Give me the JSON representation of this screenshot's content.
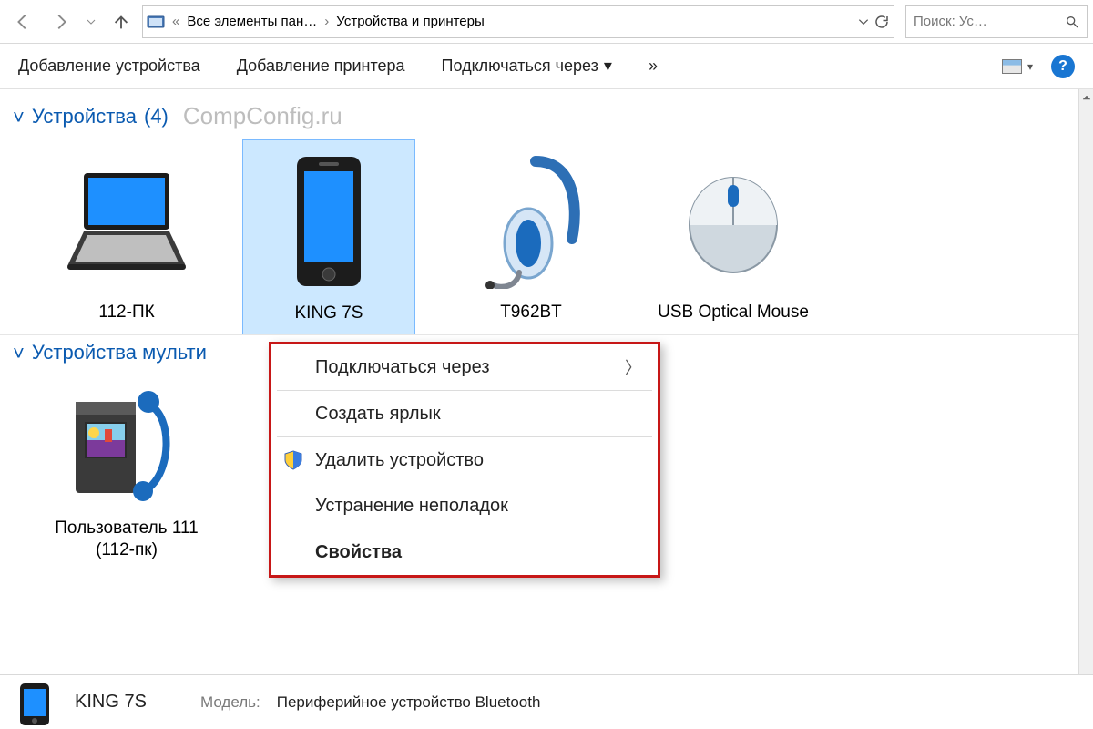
{
  "addressbar": {
    "crumb1": "Все элементы пан…",
    "crumb2": "Устройства и принтеры",
    "ellipsis": "«"
  },
  "search": {
    "placeholder": "Поиск: Ус…"
  },
  "toolbar": {
    "add_device": "Добавление устройства",
    "add_printer": "Добавление принтера",
    "connect_via": "Подключаться через",
    "more": "»"
  },
  "watermark": "CompConfig.ru",
  "groups": {
    "devices": {
      "label": "Устройства",
      "count": "(4)"
    },
    "multimedia": {
      "label_truncated": "Устройства мульти"
    }
  },
  "devices": [
    {
      "label": "112-ПК"
    },
    {
      "label": "KING 7S"
    },
    {
      "label": "T962BT"
    },
    {
      "label": "USB Optical Mouse"
    }
  ],
  "multimedia_devices": [
    {
      "label": "Пользователь 111 (112-пк)"
    }
  ],
  "context_menu": {
    "connect_via": "Подключаться через",
    "create_shortcut": "Создать ярлык",
    "remove_device": "Удалить устройство",
    "troubleshoot": "Устранение неполадок",
    "properties": "Свойства"
  },
  "details": {
    "name": "KING 7S",
    "model_label": "Модель:",
    "model_value": "Периферийное устройство Bluetooth"
  }
}
